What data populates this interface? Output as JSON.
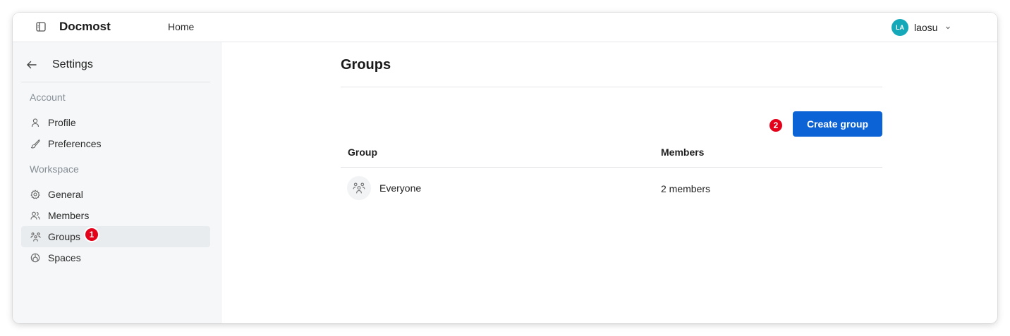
{
  "topbar": {
    "app_name": "Docmost",
    "nav_home": "Home",
    "user": {
      "initials": "LA",
      "name": "laosu",
      "avatar_color": "#14a8b8"
    }
  },
  "sidebar": {
    "title": "Settings",
    "sections": [
      {
        "label": "Account",
        "items": [
          {
            "label": "Profile",
            "icon": "user-icon"
          },
          {
            "label": "Preferences",
            "icon": "brush-icon"
          }
        ]
      },
      {
        "label": "Workspace",
        "items": [
          {
            "label": "General",
            "icon": "gear-icon"
          },
          {
            "label": "Members",
            "icon": "users-icon"
          },
          {
            "label": "Groups",
            "icon": "users-group-icon",
            "active": true,
            "badge": "1"
          },
          {
            "label": "Spaces",
            "icon": "spaces-icon"
          }
        ]
      }
    ]
  },
  "main": {
    "title": "Groups",
    "create_button": {
      "label": "Create group",
      "badge": "2"
    },
    "table": {
      "columns": [
        "Group",
        "Members"
      ],
      "rows": [
        {
          "name": "Everyone",
          "members": "2 members",
          "icon": "users-group-icon"
        }
      ]
    }
  },
  "colors": {
    "accent": "#0b63d6",
    "badge": "#e4021b",
    "sidebar_bg": "#f6f7f8",
    "active_item_bg": "#e9ecef"
  }
}
